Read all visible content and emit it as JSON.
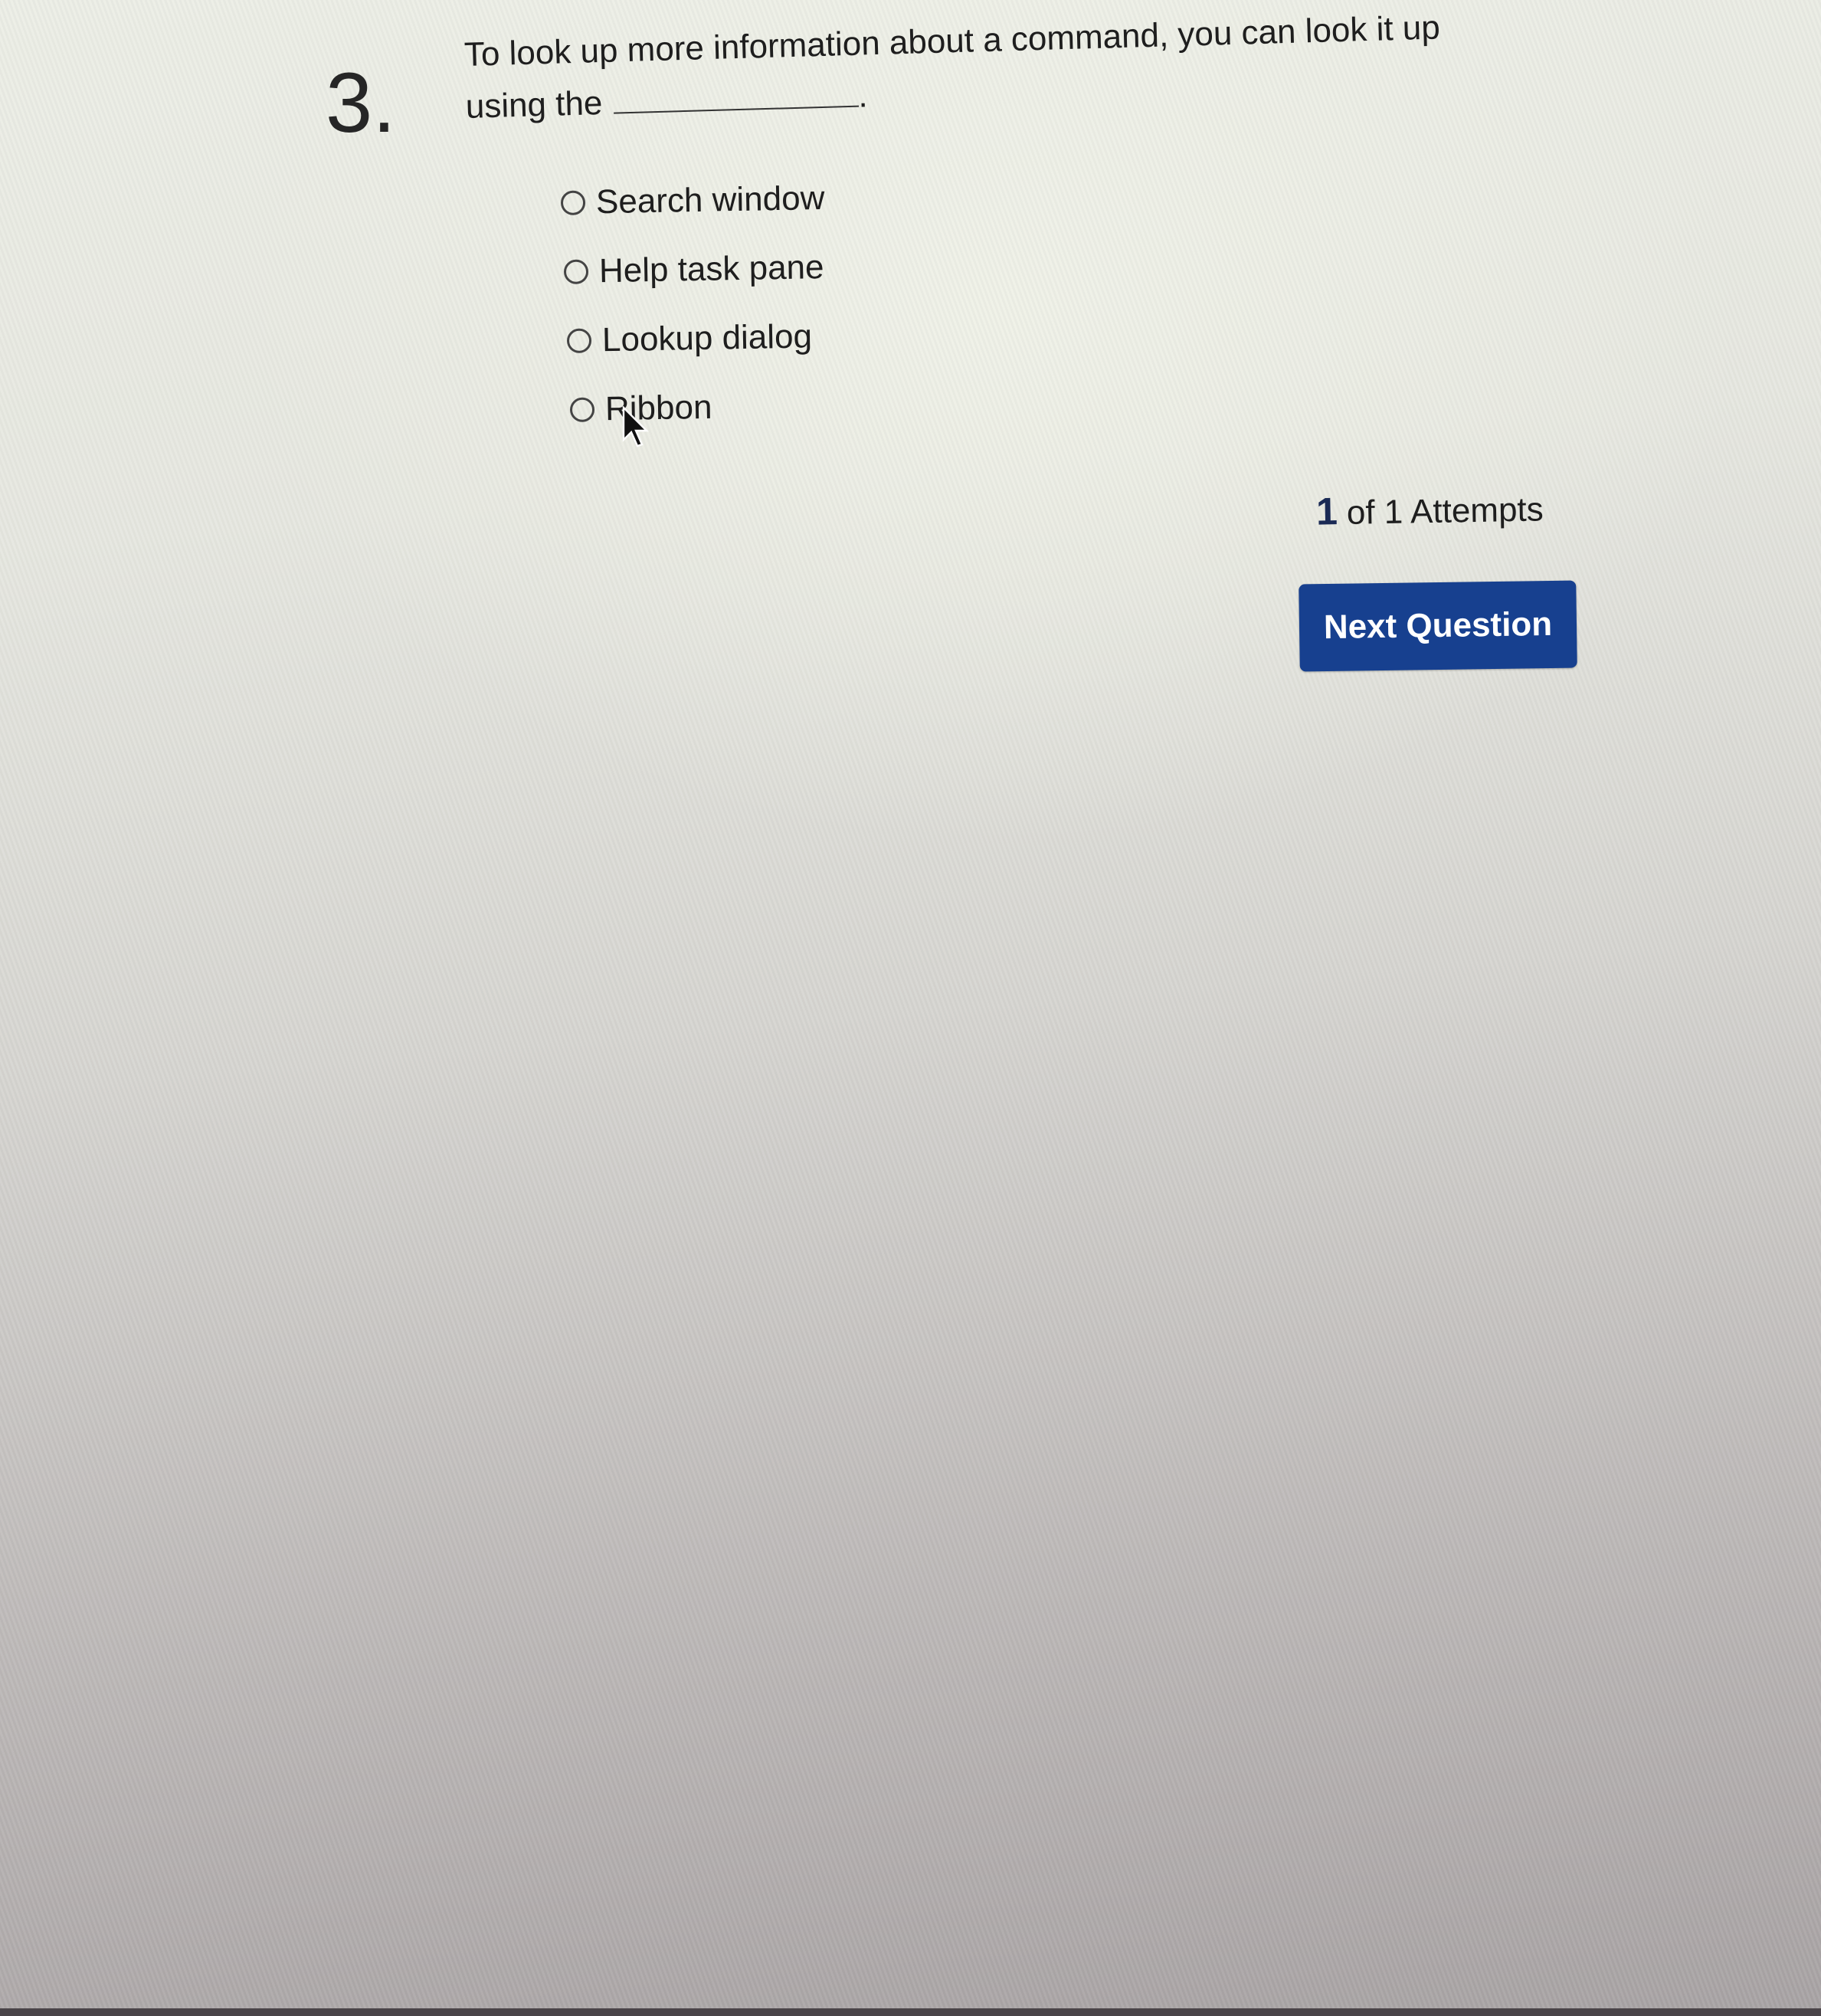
{
  "question": {
    "number": "3.",
    "text_before_blank": "To look up more information about a command, you can look it up using the",
    "text_after_blank": "."
  },
  "options": [
    {
      "label": "Search window",
      "selected": false
    },
    {
      "label": "Help task pane",
      "selected": false
    },
    {
      "label": "Lookup dialog",
      "selected": false
    },
    {
      "label": "Ribbon",
      "selected": false
    }
  ],
  "attempts": {
    "current": "1",
    "text": "of 1 Attempts"
  },
  "next_button": {
    "label": "Next Question"
  },
  "colors": {
    "button_bg": "#17408f",
    "button_text": "#ffffff"
  },
  "icons": {
    "radio": "radio-unchecked-icon",
    "cursor": "mouse-pointer-icon"
  }
}
